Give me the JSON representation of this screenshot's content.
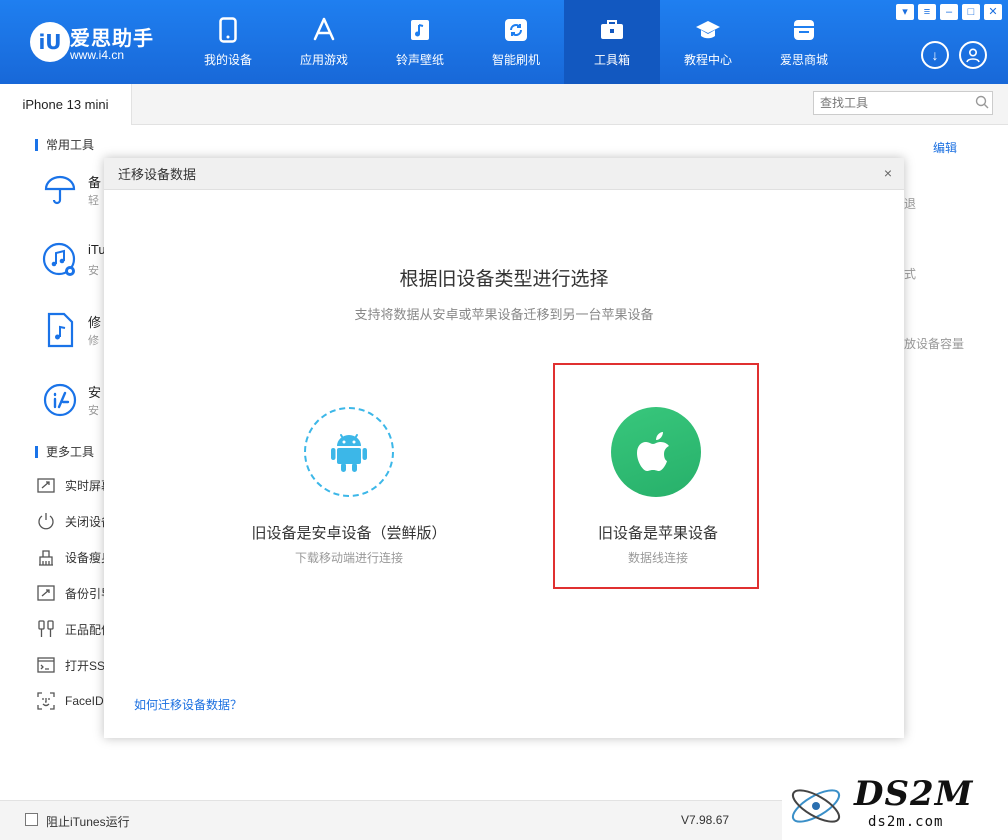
{
  "app": {
    "brand": "爱思助手",
    "url": "www.i4.cn",
    "logo_text": "iU"
  },
  "nav": {
    "items": [
      {
        "label": "我的设备",
        "icon": "phone-icon"
      },
      {
        "label": "应用游戏",
        "icon": "app-store-icon"
      },
      {
        "label": "铃声壁纸",
        "icon": "music-icon"
      },
      {
        "label": "智能刷机",
        "icon": "refresh-icon"
      },
      {
        "label": "工具箱",
        "icon": "toolbox-icon",
        "active": true
      },
      {
        "label": "教程中心",
        "icon": "graduation-cap-icon"
      },
      {
        "label": "爱思商城",
        "icon": "store-icon"
      }
    ]
  },
  "window_controls": [
    "shirt-icon",
    "menu-icon",
    "minimize-icon",
    "maximize-icon",
    "close-icon"
  ],
  "tabbar": {
    "device_tab": "iPhone 13 mini",
    "search_placeholder": "查找工具"
  },
  "main": {
    "common_tools_title": "常用工具",
    "edit_label": "编辑",
    "common_tools": [
      {
        "name": "备",
        "desc": "轻",
        "icon": "umbrella-icon"
      },
      {
        "name": "iTu",
        "desc": "安",
        "icon": "itunes-icon"
      },
      {
        "name": "修",
        "desc": "修",
        "icon": "music-file-icon"
      },
      {
        "name": "安",
        "desc": "安",
        "icon": "i4-app-icon"
      }
    ],
    "right_fragments": [
      "退",
      "式",
      "放设备容量"
    ],
    "more_tools_title": "更多工具",
    "more_tools": [
      {
        "label": "实时屏幕",
        "icon": "screen-mirror-icon"
      },
      {
        "label": "关闭设备",
        "icon": "power-icon"
      },
      {
        "label": "设备瘦身",
        "icon": "broom-icon"
      },
      {
        "label": "备份引导",
        "icon": "backup-icon"
      },
      {
        "label": "正品配件",
        "icon": "cable-icon"
      },
      {
        "label": "打开SSH",
        "icon": "terminal-icon"
      },
      {
        "label": "FaceID",
        "icon": "faceid-icon"
      }
    ]
  },
  "modal": {
    "header_title": "迁移设备数据",
    "close_label": "×",
    "title": "根据旧设备类型进行选择",
    "subtitle": "支持将数据从安卓或苹果设备迁移到另一台苹果设备",
    "options": [
      {
        "label": "旧设备是安卓设备（尝鲜版）",
        "desc": "下载移动端进行连接",
        "icon": "android-icon"
      },
      {
        "label": "旧设备是苹果设备",
        "desc": "数据线连接",
        "icon": "apple-icon",
        "highlighted": true
      }
    ],
    "help_link": "如何迁移设备数据？"
  },
  "statusbar": {
    "block_itunes_label": "阻止iTunes运行",
    "version": "V7.98.67"
  },
  "watermark": {
    "text": "DS2M",
    "sub": "ds2m.com"
  },
  "colors": {
    "header_blue": "#1a73e8",
    "active_nav": "#1258c0",
    "link_blue": "#1a6fe0",
    "highlight_red": "#e03030",
    "apple_green": "#2fbd72",
    "android_blue": "#3cb7e8"
  }
}
